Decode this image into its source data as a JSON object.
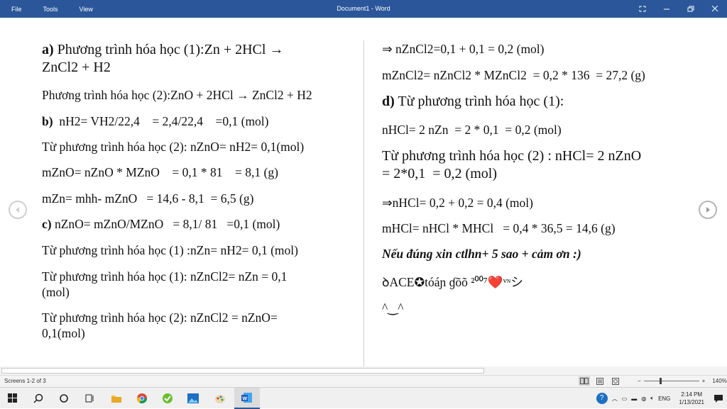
{
  "titlebar": {
    "menu": [
      "File",
      "Tools",
      "View"
    ],
    "title": "Document1  -  Word"
  },
  "left_column": [
    {
      "label": "a)",
      "text": " Phương trình hóa học (1):Zn + 2HCl →",
      "size": "big"
    },
    {
      "label": "",
      "text": "ZnCl2 + H2",
      "size": "big"
    },
    {
      "label": "",
      "text": "Phương trình hóa học (2):ZnO + 2HCl → ZnCl2 + H2",
      "size": "normal"
    },
    {
      "label": "b)",
      "text": "  nH2= VH2/22,4    = 2,4/22,4    =0,1 (mol)",
      "size": "normal"
    },
    {
      "label": "",
      "text": "Từ phương trình hóa học (2):  nZnO= nH2= 0,1(mol)",
      "size": "normal"
    },
    {
      "label": "",
      "text": "mZnO= nZnO * MZnO    = 0,1 * 81    = 8,1 (g)",
      "size": "normal"
    },
    {
      "label": "",
      "text": "mZn= mhh- mZnO   = 14,6 - 8,1  = 6,5 (g)",
      "size": "normal"
    },
    {
      "label": "c)",
      "text": " nZnO= mZnO/MZnO   = 8,1/ 81   =0,1 (mol)",
      "size": "normal"
    },
    {
      "label": "",
      "text": "Từ phương trình hóa học (1) :nZn= nH2= 0,1 (mol)",
      "size": "normal"
    },
    {
      "label": "",
      "text": "Từ phương trình hóa học (1):  nZnCl2= nZn = 0,1",
      "size": "normal"
    },
    {
      "label": "",
      "text": "(mol)",
      "size": "normal"
    },
    {
      "label": "",
      "text": "Từ phương trình hóa học (2):  nZnCl2 = nZnO=",
      "size": "normal"
    },
    {
      "label": "",
      "text": "0,1(mol)",
      "size": "normal"
    }
  ],
  "right_column": [
    {
      "label": "",
      "text": "⇒ nZnCl2=0,1 + 0,1 = 0,2 (mol)",
      "size": "normal"
    },
    {
      "label": "",
      "text": "mZnCl2= nZnCl2 * MZnCl2  = 0,2 * 136  = 27,2 (g)",
      "size": "normal"
    },
    {
      "label": "d)",
      "text": " Từ phương trình hóa học (1):",
      "size": "big"
    },
    {
      "label": "",
      "text": "nHCl= 2 nZn  = 2 * 0,1  = 0,2 (mol)",
      "size": "normal"
    },
    {
      "label": "",
      "text": "Từ phương trình hóa học (2) : nHCl= 2 nZnO",
      "size": "big"
    },
    {
      "label": "",
      "text": "= 2*0,1  = 0,2 (mol)",
      "size": "big"
    },
    {
      "label": "",
      "text": "⇒nHCl= 0,2 + 0,2 = 0,4 (mol)",
      "size": "normal"
    },
    {
      "label": "",
      "text": "mHCl= nHCl * MHCl   = 0,4 * 36,5 = 14,6 (g)",
      "size": "normal"
    },
    {
      "label": "",
      "text": "Nếu đúng xin ctlhn+ 5 sao + cảm ơn :)",
      "size": "italic"
    },
    {
      "label": "",
      "text": "ꝺACE✪tóáɲ ɠõõ ²⁰⁰⁷❤️ᵛᶰシ",
      "size": "normal"
    },
    {
      "label": "",
      "text": "^‿^",
      "size": "normal"
    }
  ],
  "statusbar": {
    "screens": "Screens 1-2 of 3",
    "zoom": "140%"
  },
  "taskbar": {
    "language": "ENG",
    "time": "2:14 PM",
    "date": "1/13/2021"
  },
  "colors": {
    "titlebar": "#2b579a",
    "taskbar": "#f0f0f0"
  }
}
